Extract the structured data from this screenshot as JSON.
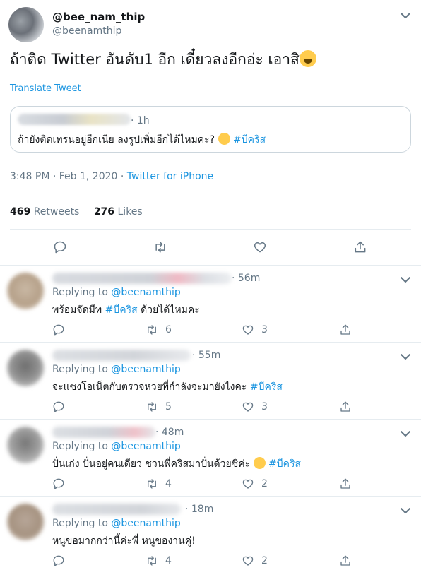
{
  "tweet": {
    "display_name": "@bee_nam_thip",
    "handle": "@beenamthip",
    "text": "ถ้าติด Twitter อันดับ1 อีก เดี๋ยวลงอีกอ่ะ เอาสิ",
    "emoji_icon": "winking-face-tongue-emoji",
    "translate_label": "Translate Tweet",
    "quote": {
      "time": "· 1h",
      "text": "ถ้ายังติดเทรนอยู่อีกเนีย ลงรูปเพิ่มอีกได้ไหมคะ?",
      "hashtag": "#บีคริส",
      "emoji_icon": "tears-of-joy-emoji"
    },
    "time": "3:48 PM · Feb 1, 2020 · ",
    "source": "Twitter for iPhone",
    "retweets_count": "469",
    "retweets_label": "Retweets",
    "likes_count": "276",
    "likes_label": "Likes"
  },
  "replies": [
    {
      "time": "· 56m",
      "replying_label": "Replying to ",
      "replying_to": "@beenamthip",
      "text": "พร้อมจัดมีท ",
      "hashtag": "#บีคริส",
      "text_after": " ด้วยได้ไหมคะ",
      "retweets": "6",
      "likes": "3"
    },
    {
      "time": "· 55m",
      "replying_label": "Replying to ",
      "replying_to": "@beenamthip",
      "text": "จะแซงโอเน็ตกับตรวจหวยที่กำลังจะมายังไงคะ ",
      "hashtag": "#บีคริส",
      "text_after": "",
      "retweets": "5",
      "likes": "3"
    },
    {
      "time": "· 48m",
      "replying_label": "Replying to ",
      "replying_to": "@beenamthip",
      "text": "ปั่นเก่ง ปั่นอยู่คนเดียว ชวนพี่คริสมาปั่นด้วยซิค่ะ ",
      "hashtag": "#บีคริส",
      "text_after": "",
      "emoji_icon": "winking-face-tongue-emoji",
      "retweets": "4",
      "likes": "2"
    },
    {
      "time": "· 18m",
      "replying_label": "Replying to ",
      "replying_to": "@beenamthip",
      "text": "หนูขอมากกว่านี้ค่ะพี่ หนูของานคู่!",
      "hashtag": "",
      "text_after": "",
      "retweets": "4",
      "likes": "2"
    }
  ],
  "colors": {
    "link": "#1b95e0",
    "muted": "#657786",
    "divider": "#e6ecf0"
  }
}
